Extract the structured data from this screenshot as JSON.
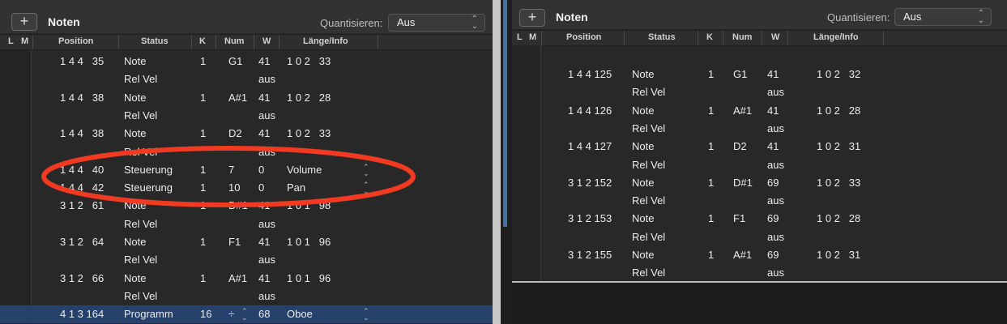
{
  "left": {
    "title": "Noten",
    "add_icon": "plus-icon",
    "quantize_label": "Quantisieren:",
    "quantize_value": "Aus",
    "columns": [
      "L",
      "M",
      "Position",
      "Status",
      "K",
      "Num",
      "W",
      "Länge/Info"
    ],
    "rows": [
      {
        "position": "1 4 4   35",
        "status": "Note",
        "ch": "1",
        "num": "G1",
        "val": "41",
        "len": "1 0 2   33"
      },
      {
        "position": "",
        "status": "Rel Vel",
        "ch": "",
        "num": "",
        "val": "aus",
        "len": ""
      },
      {
        "position": "1 4 4   38",
        "status": "Note",
        "ch": "1",
        "num": "A#1",
        "val": "41",
        "len": "1 0 2   28"
      },
      {
        "position": "",
        "status": "Rel Vel",
        "ch": "",
        "num": "",
        "val": "aus",
        "len": ""
      },
      {
        "position": "1 4 4   38",
        "status": "Note",
        "ch": "1",
        "num": "D2",
        "val": "41",
        "len": "1 0 2   33"
      },
      {
        "position": "",
        "status": "Rel Vel",
        "ch": "",
        "num": "",
        "val": "aus",
        "len": ""
      },
      {
        "position": "1 4 4   40",
        "status": "Steuerung",
        "ch": "1",
        "num": "7",
        "val": "0",
        "len": "Volume",
        "stepper": true
      },
      {
        "position": "1 4 4   42",
        "status": "Steuerung",
        "ch": "1",
        "num": "10",
        "val": "0",
        "len": "Pan",
        "stepper": true
      },
      {
        "position": "3 1 2   61",
        "status": "Note",
        "ch": "1",
        "num": "D#1",
        "val": "41",
        "len": "1 0 1   98"
      },
      {
        "position": "",
        "status": "Rel Vel",
        "ch": "",
        "num": "",
        "val": "aus",
        "len": ""
      },
      {
        "position": "3 1 2   64",
        "status": "Note",
        "ch": "1",
        "num": "F1",
        "val": "41",
        "len": "1 0 1   96"
      },
      {
        "position": "",
        "status": "Rel Vel",
        "ch": "",
        "num": "",
        "val": "aus",
        "len": ""
      },
      {
        "position": "3 1 2   66",
        "status": "Note",
        "ch": "1",
        "num": "A#1",
        "val": "41",
        "len": "1 0 1   96"
      },
      {
        "position": "",
        "status": "Rel Vel",
        "ch": "",
        "num": "",
        "val": "aus",
        "len": ""
      },
      {
        "position": "4 1 3 164",
        "status": "Programm",
        "ch": "16",
        "num": "÷",
        "val": "68",
        "len": "Oboe",
        "stepper": true,
        "num_stepper": true,
        "selected": true
      }
    ]
  },
  "right": {
    "title": "Noten",
    "add_icon": "plus-icon",
    "quantize_label": "Quantisieren:",
    "quantize_value": "Aus",
    "columns": [
      "L",
      "M",
      "Position",
      "Status",
      "K",
      "Num",
      "W",
      "Länge/Info"
    ],
    "rows": [
      {
        "position": "1 4 4 125",
        "status": "Note",
        "ch": "1",
        "num": "G1",
        "val": "41",
        "len": "1 0 2   32"
      },
      {
        "position": "",
        "status": "Rel Vel",
        "ch": "",
        "num": "",
        "val": "aus",
        "len": ""
      },
      {
        "position": "1 4 4 126",
        "status": "Note",
        "ch": "1",
        "num": "A#1",
        "val": "41",
        "len": "1 0 2   28"
      },
      {
        "position": "",
        "status": "Rel Vel",
        "ch": "",
        "num": "",
        "val": "aus",
        "len": ""
      },
      {
        "position": "1 4 4 127",
        "status": "Note",
        "ch": "1",
        "num": "D2",
        "val": "41",
        "len": "1 0 2   31"
      },
      {
        "position": "",
        "status": "Rel Vel",
        "ch": "",
        "num": "",
        "val": "aus",
        "len": ""
      },
      {
        "position": "3 1 2 152",
        "status": "Note",
        "ch": "1",
        "num": "D#1",
        "val": "69",
        "len": "1 0 2   33"
      },
      {
        "position": "",
        "status": "Rel Vel",
        "ch": "",
        "num": "",
        "val": "aus",
        "len": ""
      },
      {
        "position": "3 1 2 153",
        "status": "Note",
        "ch": "1",
        "num": "F1",
        "val": "69",
        "len": "1 0 2   28"
      },
      {
        "position": "",
        "status": "Rel Vel",
        "ch": "",
        "num": "",
        "val": "aus",
        "len": ""
      },
      {
        "position": "3 1 2 155",
        "status": "Note",
        "ch": "1",
        "num": "A#1",
        "val": "69",
        "len": "1 0 2   31"
      },
      {
        "position": "",
        "status": "Rel Vel",
        "ch": "",
        "num": "",
        "val": "aus",
        "len": ""
      }
    ]
  },
  "annotation": {
    "color": "#f03a22"
  }
}
